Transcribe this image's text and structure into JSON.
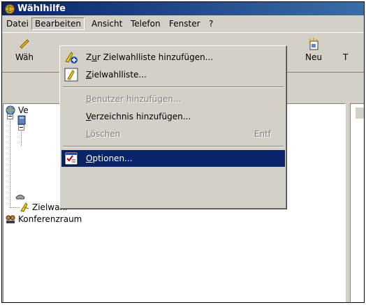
{
  "window": {
    "title": "Wählhilfe",
    "icon": "globe-app-icon"
  },
  "menubar": {
    "items": [
      "Datei",
      "Bearbeiten",
      "Ansicht",
      "Telefon",
      "Fenster",
      "?"
    ],
    "active": "Bearbeiten"
  },
  "toolbar": {
    "left_label": "Wäh",
    "new_label": "Neu",
    "right_label": "T"
  },
  "tree": {
    "root_partial": "Ve",
    "zielwahl": "Zielwahl",
    "konferenzraum": "Konferenzraum"
  },
  "edit_menu": {
    "items": [
      {
        "label_pre": "Z",
        "label_ul": "u",
        "label_post": "r Zielwahlliste hinzufügen...",
        "icon": "add-speed-dial-icon",
        "disabled": false,
        "selected": false
      },
      {
        "label_pre": "",
        "label_ul": "Z",
        "label_post": "ielwahlliste...",
        "icon": "speed-dial-list-icon",
        "disabled": false,
        "selected": false
      },
      {
        "label_pre": "",
        "label_ul": "B",
        "label_post": "enutzer hinzufügen...",
        "icon": "",
        "disabled": true,
        "selected": false
      },
      {
        "label_pre": "",
        "label_ul": "V",
        "label_post": "erzeichnis hinzufügen...",
        "icon": "",
        "disabled": false,
        "selected": false
      },
      {
        "label_pre": "",
        "label_ul": "L",
        "label_post": "öschen",
        "shortcut": "Entf",
        "icon": "",
        "disabled": true,
        "selected": false
      },
      {
        "label_pre": "",
        "label_ul": "O",
        "label_post": "ptionen...",
        "icon": "options-icon",
        "disabled": false,
        "selected": true
      }
    ]
  },
  "colors": {
    "titlebar_start": "#0a246a",
    "titlebar_end": "#3a6ea5",
    "face": "#d4d0c8",
    "highlight": "#0a246a"
  }
}
